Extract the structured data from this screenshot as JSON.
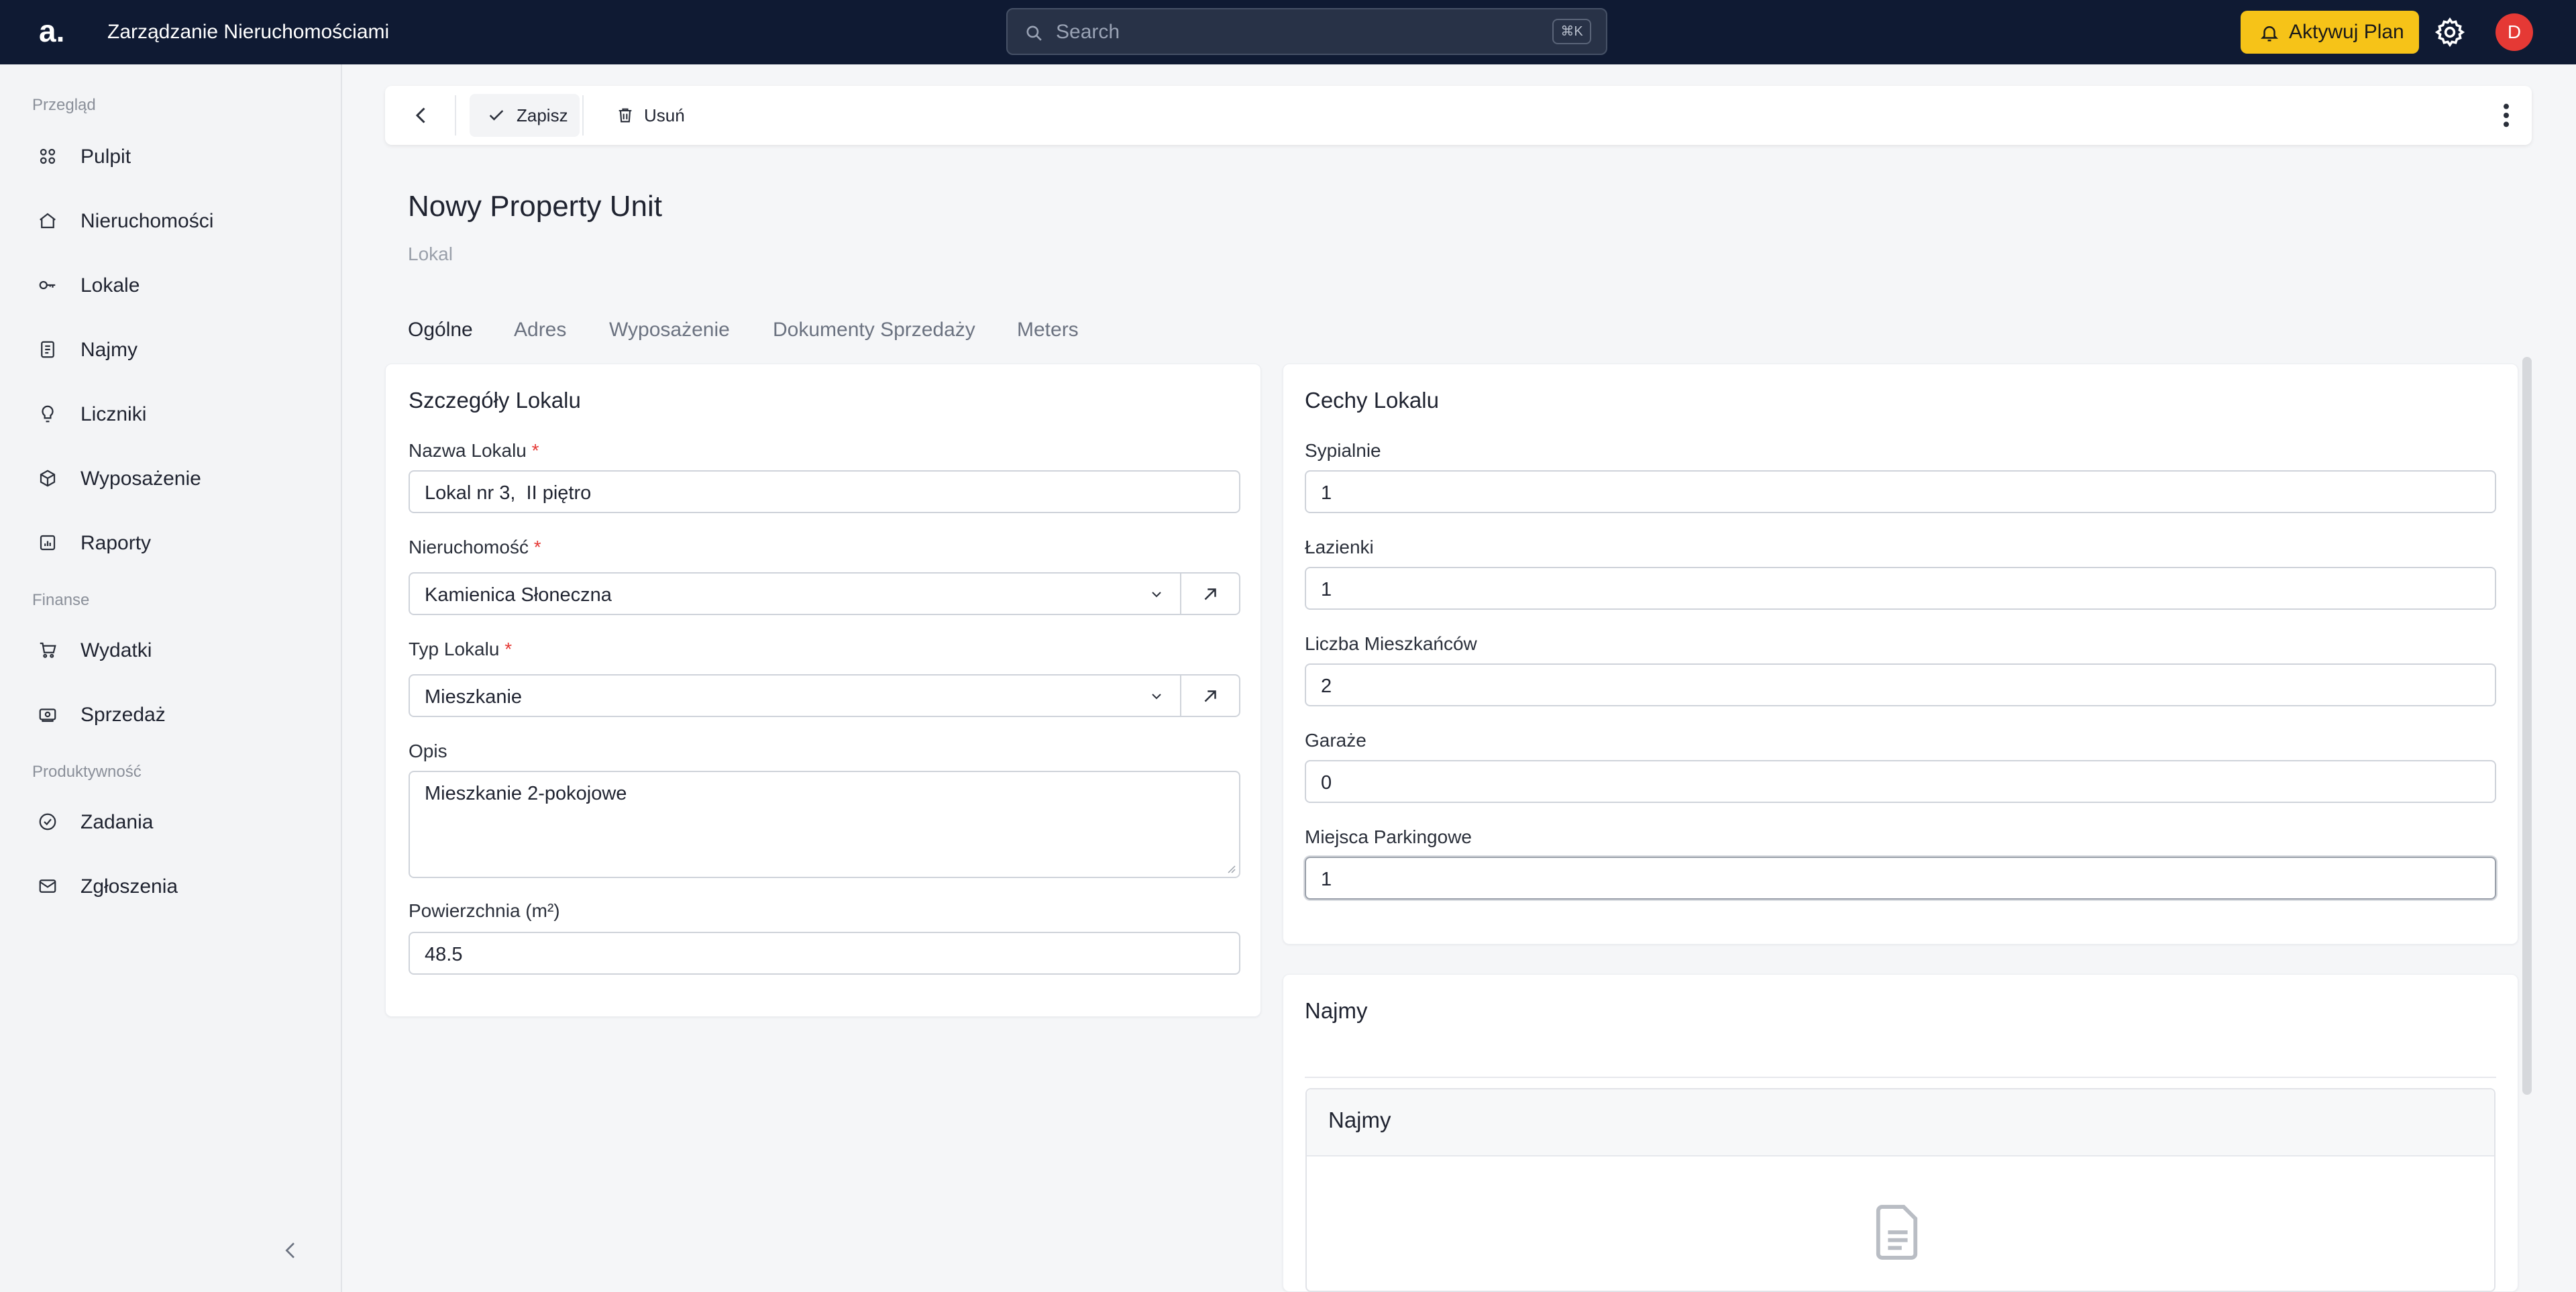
{
  "app": {
    "logo": "a.",
    "title": "Zarządzanie Nieruchomościami",
    "search_placeholder": "Search",
    "search_shortcut": "⌘K",
    "plan_button": "Aktywuj Plan",
    "avatar_initial": "D"
  },
  "sidebar": {
    "sections": [
      {
        "label": "Przegląd",
        "items": [
          "Pulpit",
          "Nieruchomości",
          "Lokale",
          "Najmy",
          "Liczniki",
          "Wyposażenie",
          "Raporty"
        ]
      },
      {
        "label": "Finanse",
        "items": [
          "Wydatki",
          "Sprzedaż"
        ]
      },
      {
        "label": "Produktywność",
        "items": [
          "Zadania",
          "Zgłoszenia"
        ]
      }
    ]
  },
  "toolbar": {
    "save_label": "Zapisz",
    "delete_label": "Usuń"
  },
  "page": {
    "title": "Nowy Property Unit",
    "subtitle": "Lokal"
  },
  "tabs": [
    "Ogólne",
    "Adres",
    "Wyposażenie",
    "Dokumenty Sprzedaży",
    "Meters"
  ],
  "details": {
    "title": "Szczegóły Lokalu",
    "name_label": "Nazwa Lokalu",
    "name_value": "Lokal nr 3,  II piętro",
    "property_label": "Nieruchomość",
    "property_value": "Kamienica Słoneczna",
    "type_label": "Typ Lokalu",
    "type_value": "Mieszkanie",
    "desc_label": "Opis",
    "desc_value": "Mieszkanie 2-pokojowe",
    "area_label": "Powierzchnia (m²)",
    "area_value": "48.5",
    "required_mark": "*"
  },
  "features": {
    "title": "Cechy Lokalu",
    "bedrooms_label": "Sypialnie",
    "bedrooms_value": "1",
    "bathrooms_label": "Łazienki",
    "bathrooms_value": "1",
    "residents_label": "Liczba Mieszkańców",
    "residents_value": "2",
    "garages_label": "Garaże",
    "garages_value": "0",
    "parking_label": "Miejsca Parkingowe",
    "parking_value": "1"
  },
  "rentals": {
    "title": "Najmy",
    "inner_title": "Najmy"
  },
  "colors": {
    "topbar": "#0f1a33",
    "accent": "#f6c318",
    "avatar": "#e53935",
    "required": "#e53935"
  }
}
